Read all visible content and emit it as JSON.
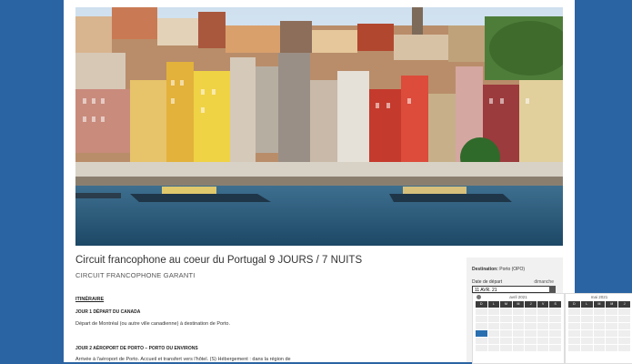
{
  "content": {
    "title": "Circuit francophone au coeur du Portugal 9 JOURS / 7 NUITS",
    "subtitle": "CIRCUIT FRANCOPHONE GARANTI",
    "itinerary_heading": "ITINÉRAIRE",
    "days": [
      {
        "heading": "JOUR 1 DÉPART DU CANADA",
        "text": "Départ de Montréal (ou autre ville canadienne) à destination de Porto."
      },
      {
        "heading": "JOUR 2 AÉROPORT DE PORTO – PORTO OU ENVIRONS",
        "text": "Arrivée à l'aéroport de Porto. Accueil et transfert vers l'hôtel. (S) Hébergement : dans la région de"
      }
    ]
  },
  "booking": {
    "destination_label": "Destination:",
    "destination_value": "Porto (OPO)",
    "date_label": "Date de départ",
    "date_day": "dimanche",
    "date_value": "11 AVR. 21"
  },
  "calendar": {
    "month1": "avril 2021",
    "month2": "mai 2021",
    "weekdays": [
      "D",
      "L",
      "M",
      "M",
      "J",
      "V",
      "S"
    ],
    "weekdays2": [
      "D",
      "L",
      "M",
      "M",
      "J"
    ]
  }
}
